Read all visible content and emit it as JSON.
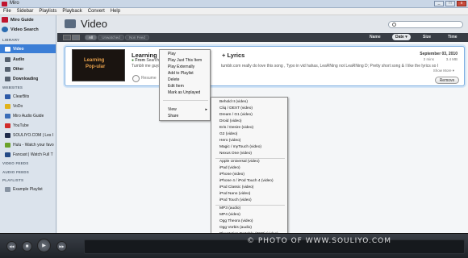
{
  "app": {
    "title": "Miro"
  },
  "window_controls": {
    "minimize": "_",
    "maximize": "□",
    "close": "x"
  },
  "menubar": [
    "File",
    "Sidebar",
    "Playlists",
    "Playback",
    "Convert",
    "Help"
  ],
  "sidebar": {
    "top": [
      {
        "label": "Miro Guide",
        "icon": "miro-guide-icon",
        "color": "#c0152f"
      },
      {
        "label": "Video Search",
        "icon": "video-search-icon",
        "color": "#2b6cb0"
      }
    ],
    "library_header": "LIBRARY",
    "library": [
      {
        "label": "Video",
        "icon": "video-icon",
        "selected": true
      },
      {
        "label": "Audio",
        "icon": "audio-icon"
      },
      {
        "label": "Other",
        "icon": "other-icon"
      },
      {
        "label": "Downloading",
        "icon": "downloading-icon"
      }
    ],
    "websites_header": "WEBSITES",
    "websites": [
      {
        "label": "ClearBits",
        "color": "#2d5aa7"
      },
      {
        "label": "VoDo",
        "color": "#e1b21a"
      },
      {
        "label": "Miro Audio Guide",
        "color": "#3a6db8"
      },
      {
        "label": "YouTube",
        "color": "#d12b2b"
      },
      {
        "label": "SOULIYO.COM | Les I",
        "color": "#1f2b4a"
      },
      {
        "label": "Hulu - Watch your favo",
        "color": "#6aa22a"
      },
      {
        "label": "Fancast | Watch Full T",
        "color": "#244a86"
      }
    ],
    "video_feeds_header": "VIDEO FEEDS",
    "audio_feeds_header": "AUDIO FEEDS",
    "playlists_header": "PLAYLISTS",
    "playlists": [
      {
        "label": "Example Playlist"
      }
    ]
  },
  "main": {
    "title": "Video",
    "search": {
      "placeholder": ""
    },
    "filters": [
      "All",
      "Unwatched",
      "Non Feed"
    ],
    "columns": {
      "name": "Name",
      "date": "Date ▾",
      "size": "Size",
      "time": "Time"
    }
  },
  "item": {
    "thumbnail_text1": "Learning",
    "thumbnail_text2": "Pop-ular",
    "title": "Learning Lo",
    "title_suffix": "+ Lyrics",
    "from_label": "From",
    "from_value": "Search",
    "description": "Tumblr me guys",
    "description_suffix": "tumblr.com really do love this song , Typo in vid hahas, LeaRNing not LeaRNing D; Pretty short song & I like the lyrics so I",
    "resume": "Resume",
    "date": "September 03, 2010",
    "meta_age": "2 mins",
    "meta_size": "3.4 MB",
    "show_more": "Show More ▾",
    "remove": "Remove"
  },
  "context_menu": {
    "items": [
      "Play",
      "Play Just This Item",
      "Play Externally",
      "Add to Playlist",
      "Delete",
      "Edit Item",
      "Mark as Unplayed"
    ],
    "view": "View",
    "share": "Share",
    "arrow": "▸"
  },
  "convert_submenu": {
    "group1": [
      "Behold II (video)",
      "Cliq / DEXT (video)",
      "Dream / G1 (video)",
      "Droid (video)",
      "Eris / Desire (video)",
      "G2 (video)",
      "Hero (video)",
      "Magic / myTouch (video)",
      "Nexus One (video)"
    ],
    "group2": [
      "Apple Universal (video)",
      "iPad (video)",
      "iPhone (video)",
      "iPhone 4 / iPod Touch 4 (video)",
      "iPod Classic (video)",
      "iPod Nano (video)",
      "iPod Touch (video)"
    ],
    "group3": [
      "MP3 (audio)",
      "MP4 (video)",
      "Ogg Theora (video)",
      "Ogg Vorbis (audio)",
      "Playstation Portable (PSP) (video)"
    ],
    "footer": "Show Conversion Folder"
  },
  "player": {
    "prev": "◀◀",
    "stop": "■",
    "play": "▶",
    "next": "▶▶"
  },
  "watermark": "© PHOTO OF WWW.SOULIYO.COM"
}
